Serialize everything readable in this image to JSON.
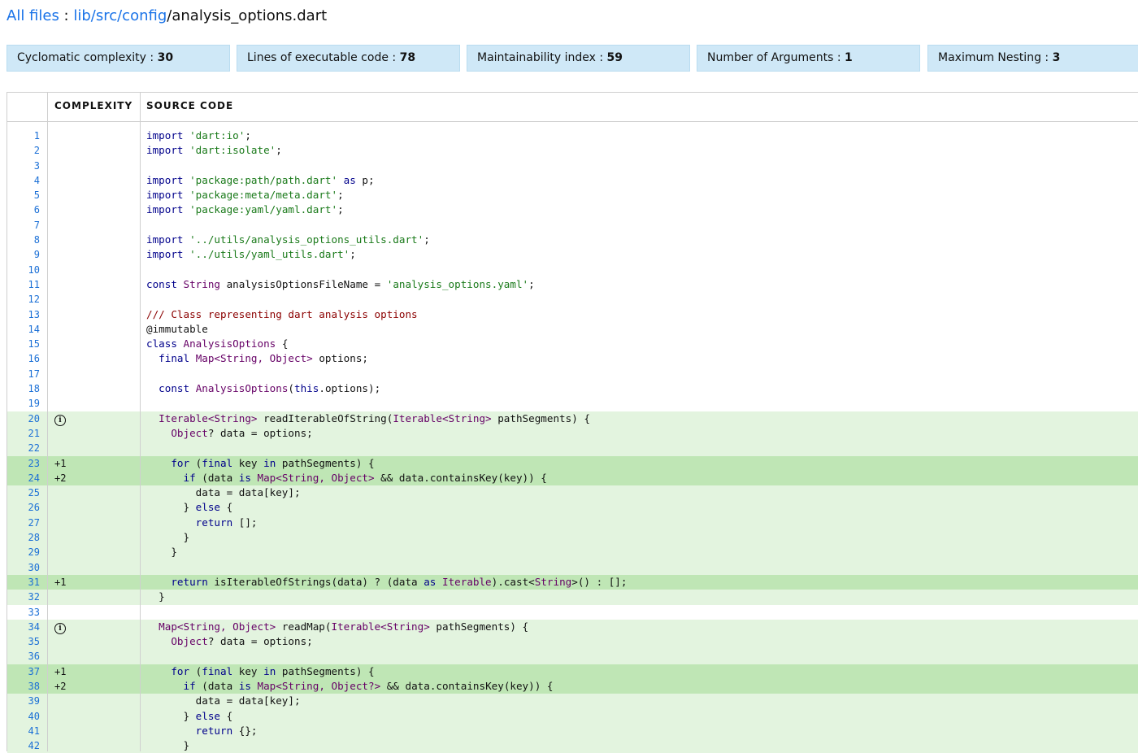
{
  "breadcrumb": {
    "root": "All files",
    "separator": " : ",
    "path": "lib/src/config",
    "slash": "/",
    "file": "analysis_options.dart"
  },
  "metrics": [
    {
      "label": "Cyclomatic complexity",
      "value": "30"
    },
    {
      "label": "Lines of executable code",
      "value": "78"
    },
    {
      "label": "Maintainability index",
      "value": "59"
    },
    {
      "label": "Number of Arguments",
      "value": "1"
    },
    {
      "label": "Maximum Nesting",
      "value": "3"
    }
  ],
  "table": {
    "headers": {
      "complexity": "COMPLEXITY",
      "source": "SOURCE CODE"
    }
  },
  "colors": {
    "link": "#1a73e8",
    "metric_bg": "#cfe8f7",
    "method_bg": "#e3f4df",
    "complexity_bg": "#bfe6b5",
    "keyword": "#00008b",
    "string": "#1a7a1a",
    "type": "#660066",
    "comment": "#8b0000"
  },
  "lines": [
    {
      "n": "1",
      "cx": "",
      "hl": "",
      "code": [
        [
          "kw",
          "import"
        ],
        [
          "pl",
          " "
        ],
        [
          "str",
          "'dart:io'"
        ],
        [
          "pl",
          ";"
        ]
      ]
    },
    {
      "n": "2",
      "cx": "",
      "hl": "",
      "code": [
        [
          "kw",
          "import"
        ],
        [
          "pl",
          " "
        ],
        [
          "str",
          "'dart:isolate'"
        ],
        [
          "pl",
          ";"
        ]
      ]
    },
    {
      "n": "3",
      "cx": "",
      "hl": "",
      "code": []
    },
    {
      "n": "4",
      "cx": "",
      "hl": "",
      "code": [
        [
          "kw",
          "import"
        ],
        [
          "pl",
          " "
        ],
        [
          "str",
          "'package:path/path.dart'"
        ],
        [
          "pl",
          " "
        ],
        [
          "kw",
          "as"
        ],
        [
          "pl",
          " p;"
        ]
      ]
    },
    {
      "n": "5",
      "cx": "",
      "hl": "",
      "code": [
        [
          "kw",
          "import"
        ],
        [
          "pl",
          " "
        ],
        [
          "str",
          "'package:meta/meta.dart'"
        ],
        [
          "pl",
          ";"
        ]
      ]
    },
    {
      "n": "6",
      "cx": "",
      "hl": "",
      "code": [
        [
          "kw",
          "import"
        ],
        [
          "pl",
          " "
        ],
        [
          "str",
          "'package:yaml/yaml.dart'"
        ],
        [
          "pl",
          ";"
        ]
      ]
    },
    {
      "n": "7",
      "cx": "",
      "hl": "",
      "code": []
    },
    {
      "n": "8",
      "cx": "",
      "hl": "",
      "code": [
        [
          "kw",
          "import"
        ],
        [
          "pl",
          " "
        ],
        [
          "str",
          "'../utils/analysis_options_utils.dart'"
        ],
        [
          "pl",
          ";"
        ]
      ]
    },
    {
      "n": "9",
      "cx": "",
      "hl": "",
      "code": [
        [
          "kw",
          "import"
        ],
        [
          "pl",
          " "
        ],
        [
          "str",
          "'../utils/yaml_utils.dart'"
        ],
        [
          "pl",
          ";"
        ]
      ]
    },
    {
      "n": "10",
      "cx": "",
      "hl": "",
      "code": []
    },
    {
      "n": "11",
      "cx": "",
      "hl": "",
      "code": [
        [
          "kw",
          "const"
        ],
        [
          "pl",
          " "
        ],
        [
          "ty",
          "String"
        ],
        [
          "pl",
          " analysisOptionsFileName = "
        ],
        [
          "str",
          "'analysis_options.yaml'"
        ],
        [
          "pl",
          ";"
        ]
      ]
    },
    {
      "n": "12",
      "cx": "",
      "hl": "",
      "code": []
    },
    {
      "n": "13",
      "cx": "",
      "hl": "",
      "code": [
        [
          "cm",
          "/// Class representing dart analysis options"
        ]
      ]
    },
    {
      "n": "14",
      "cx": "",
      "hl": "",
      "code": [
        [
          "pl",
          "@immutable"
        ]
      ]
    },
    {
      "n": "15",
      "cx": "",
      "hl": "",
      "code": [
        [
          "kw",
          "class"
        ],
        [
          "pl",
          " "
        ],
        [
          "ty",
          "AnalysisOptions"
        ],
        [
          "pl",
          " {"
        ]
      ]
    },
    {
      "n": "16",
      "cx": "",
      "hl": "",
      "code": [
        [
          "pl",
          "  "
        ],
        [
          "kw",
          "final"
        ],
        [
          "pl",
          " "
        ],
        [
          "ty",
          "Map<String, Object>"
        ],
        [
          "pl",
          " options;"
        ]
      ]
    },
    {
      "n": "17",
      "cx": "",
      "hl": "",
      "code": []
    },
    {
      "n": "18",
      "cx": "",
      "hl": "",
      "code": [
        [
          "pl",
          "  "
        ],
        [
          "kw",
          "const"
        ],
        [
          "pl",
          " "
        ],
        [
          "ty",
          "AnalysisOptions"
        ],
        [
          "pl",
          "("
        ],
        [
          "kw",
          "this"
        ],
        [
          "pl",
          ".options);"
        ]
      ]
    },
    {
      "n": "19",
      "cx": "",
      "hl": "",
      "code": []
    },
    {
      "n": "20",
      "cx": "info",
      "hl": "g1",
      "code": [
        [
          "pl",
          "  "
        ],
        [
          "ty",
          "Iterable<String>"
        ],
        [
          "pl",
          " readIterableOfString("
        ],
        [
          "ty",
          "Iterable<String>"
        ],
        [
          "pl",
          " pathSegments) {"
        ]
      ]
    },
    {
      "n": "21",
      "cx": "",
      "hl": "g1",
      "code": [
        [
          "pl",
          "    "
        ],
        [
          "ty",
          "Object"
        ],
        [
          "pl",
          "? data = options;"
        ]
      ]
    },
    {
      "n": "22",
      "cx": "",
      "hl": "g1",
      "code": []
    },
    {
      "n": "23",
      "cx": "+1",
      "hl": "g2",
      "code": [
        [
          "pl",
          "    "
        ],
        [
          "kw",
          "for"
        ],
        [
          "pl",
          " ("
        ],
        [
          "kw",
          "final"
        ],
        [
          "pl",
          " key "
        ],
        [
          "kw",
          "in"
        ],
        [
          "pl",
          " pathSegments) {"
        ]
      ]
    },
    {
      "n": "24",
      "cx": "+2",
      "hl": "g2",
      "code": [
        [
          "pl",
          "      "
        ],
        [
          "kw",
          "if"
        ],
        [
          "pl",
          " (data "
        ],
        [
          "kw",
          "is"
        ],
        [
          "pl",
          " "
        ],
        [
          "ty",
          "Map<String, Object>"
        ],
        [
          "pl",
          " && data.containsKey(key)) {"
        ]
      ]
    },
    {
      "n": "25",
      "cx": "",
      "hl": "g1",
      "code": [
        [
          "pl",
          "        data = data[key];"
        ]
      ]
    },
    {
      "n": "26",
      "cx": "",
      "hl": "g1",
      "code": [
        [
          "pl",
          "      } "
        ],
        [
          "kw",
          "else"
        ],
        [
          "pl",
          " {"
        ]
      ]
    },
    {
      "n": "27",
      "cx": "",
      "hl": "g1",
      "code": [
        [
          "pl",
          "        "
        ],
        [
          "kw",
          "return"
        ],
        [
          "pl",
          " [];"
        ]
      ]
    },
    {
      "n": "28",
      "cx": "",
      "hl": "g1",
      "code": [
        [
          "pl",
          "      }"
        ]
      ]
    },
    {
      "n": "29",
      "cx": "",
      "hl": "g1",
      "code": [
        [
          "pl",
          "    }"
        ]
      ]
    },
    {
      "n": "30",
      "cx": "",
      "hl": "g1",
      "code": []
    },
    {
      "n": "31",
      "cx": "+1",
      "hl": "g2",
      "code": [
        [
          "pl",
          "    "
        ],
        [
          "kw",
          "return"
        ],
        [
          "pl",
          " isIterableOfStrings(data) ? (data "
        ],
        [
          "kw",
          "as"
        ],
        [
          "pl",
          " "
        ],
        [
          "ty",
          "Iterable"
        ],
        [
          "pl",
          ").cast<"
        ],
        [
          "ty",
          "String"
        ],
        [
          "pl",
          ">() : [];"
        ]
      ]
    },
    {
      "n": "32",
      "cx": "",
      "hl": "g1",
      "code": [
        [
          "pl",
          "  }"
        ]
      ]
    },
    {
      "n": "33",
      "cx": "",
      "hl": "",
      "code": []
    },
    {
      "n": "34",
      "cx": "info",
      "hl": "g1",
      "code": [
        [
          "pl",
          "  "
        ],
        [
          "ty",
          "Map<String, Object>"
        ],
        [
          "pl",
          " readMap("
        ],
        [
          "ty",
          "Iterable<String>"
        ],
        [
          "pl",
          " pathSegments) {"
        ]
      ]
    },
    {
      "n": "35",
      "cx": "",
      "hl": "g1",
      "code": [
        [
          "pl",
          "    "
        ],
        [
          "ty",
          "Object"
        ],
        [
          "pl",
          "? data = options;"
        ]
      ]
    },
    {
      "n": "36",
      "cx": "",
      "hl": "g1",
      "code": []
    },
    {
      "n": "37",
      "cx": "+1",
      "hl": "g2",
      "code": [
        [
          "pl",
          "    "
        ],
        [
          "kw",
          "for"
        ],
        [
          "pl",
          " ("
        ],
        [
          "kw",
          "final"
        ],
        [
          "pl",
          " key "
        ],
        [
          "kw",
          "in"
        ],
        [
          "pl",
          " pathSegments) {"
        ]
      ]
    },
    {
      "n": "38",
      "cx": "+2",
      "hl": "g2",
      "code": [
        [
          "pl",
          "      "
        ],
        [
          "kw",
          "if"
        ],
        [
          "pl",
          " (data "
        ],
        [
          "kw",
          "is"
        ],
        [
          "pl",
          " "
        ],
        [
          "ty",
          "Map<String, Object?>"
        ],
        [
          "pl",
          " && data.containsKey(key)) {"
        ]
      ]
    },
    {
      "n": "39",
      "cx": "",
      "hl": "g1",
      "code": [
        [
          "pl",
          "        data = data[key];"
        ]
      ]
    },
    {
      "n": "40",
      "cx": "",
      "hl": "g1",
      "code": [
        [
          "pl",
          "      } "
        ],
        [
          "kw",
          "else"
        ],
        [
          "pl",
          " {"
        ]
      ]
    },
    {
      "n": "41",
      "cx": "",
      "hl": "g1",
      "code": [
        [
          "pl",
          "        "
        ],
        [
          "kw",
          "return"
        ],
        [
          "pl",
          " {};"
        ]
      ]
    },
    {
      "n": "42",
      "cx": "",
      "hl": "g1",
      "code": [
        [
          "pl",
          "      }"
        ]
      ]
    }
  ]
}
